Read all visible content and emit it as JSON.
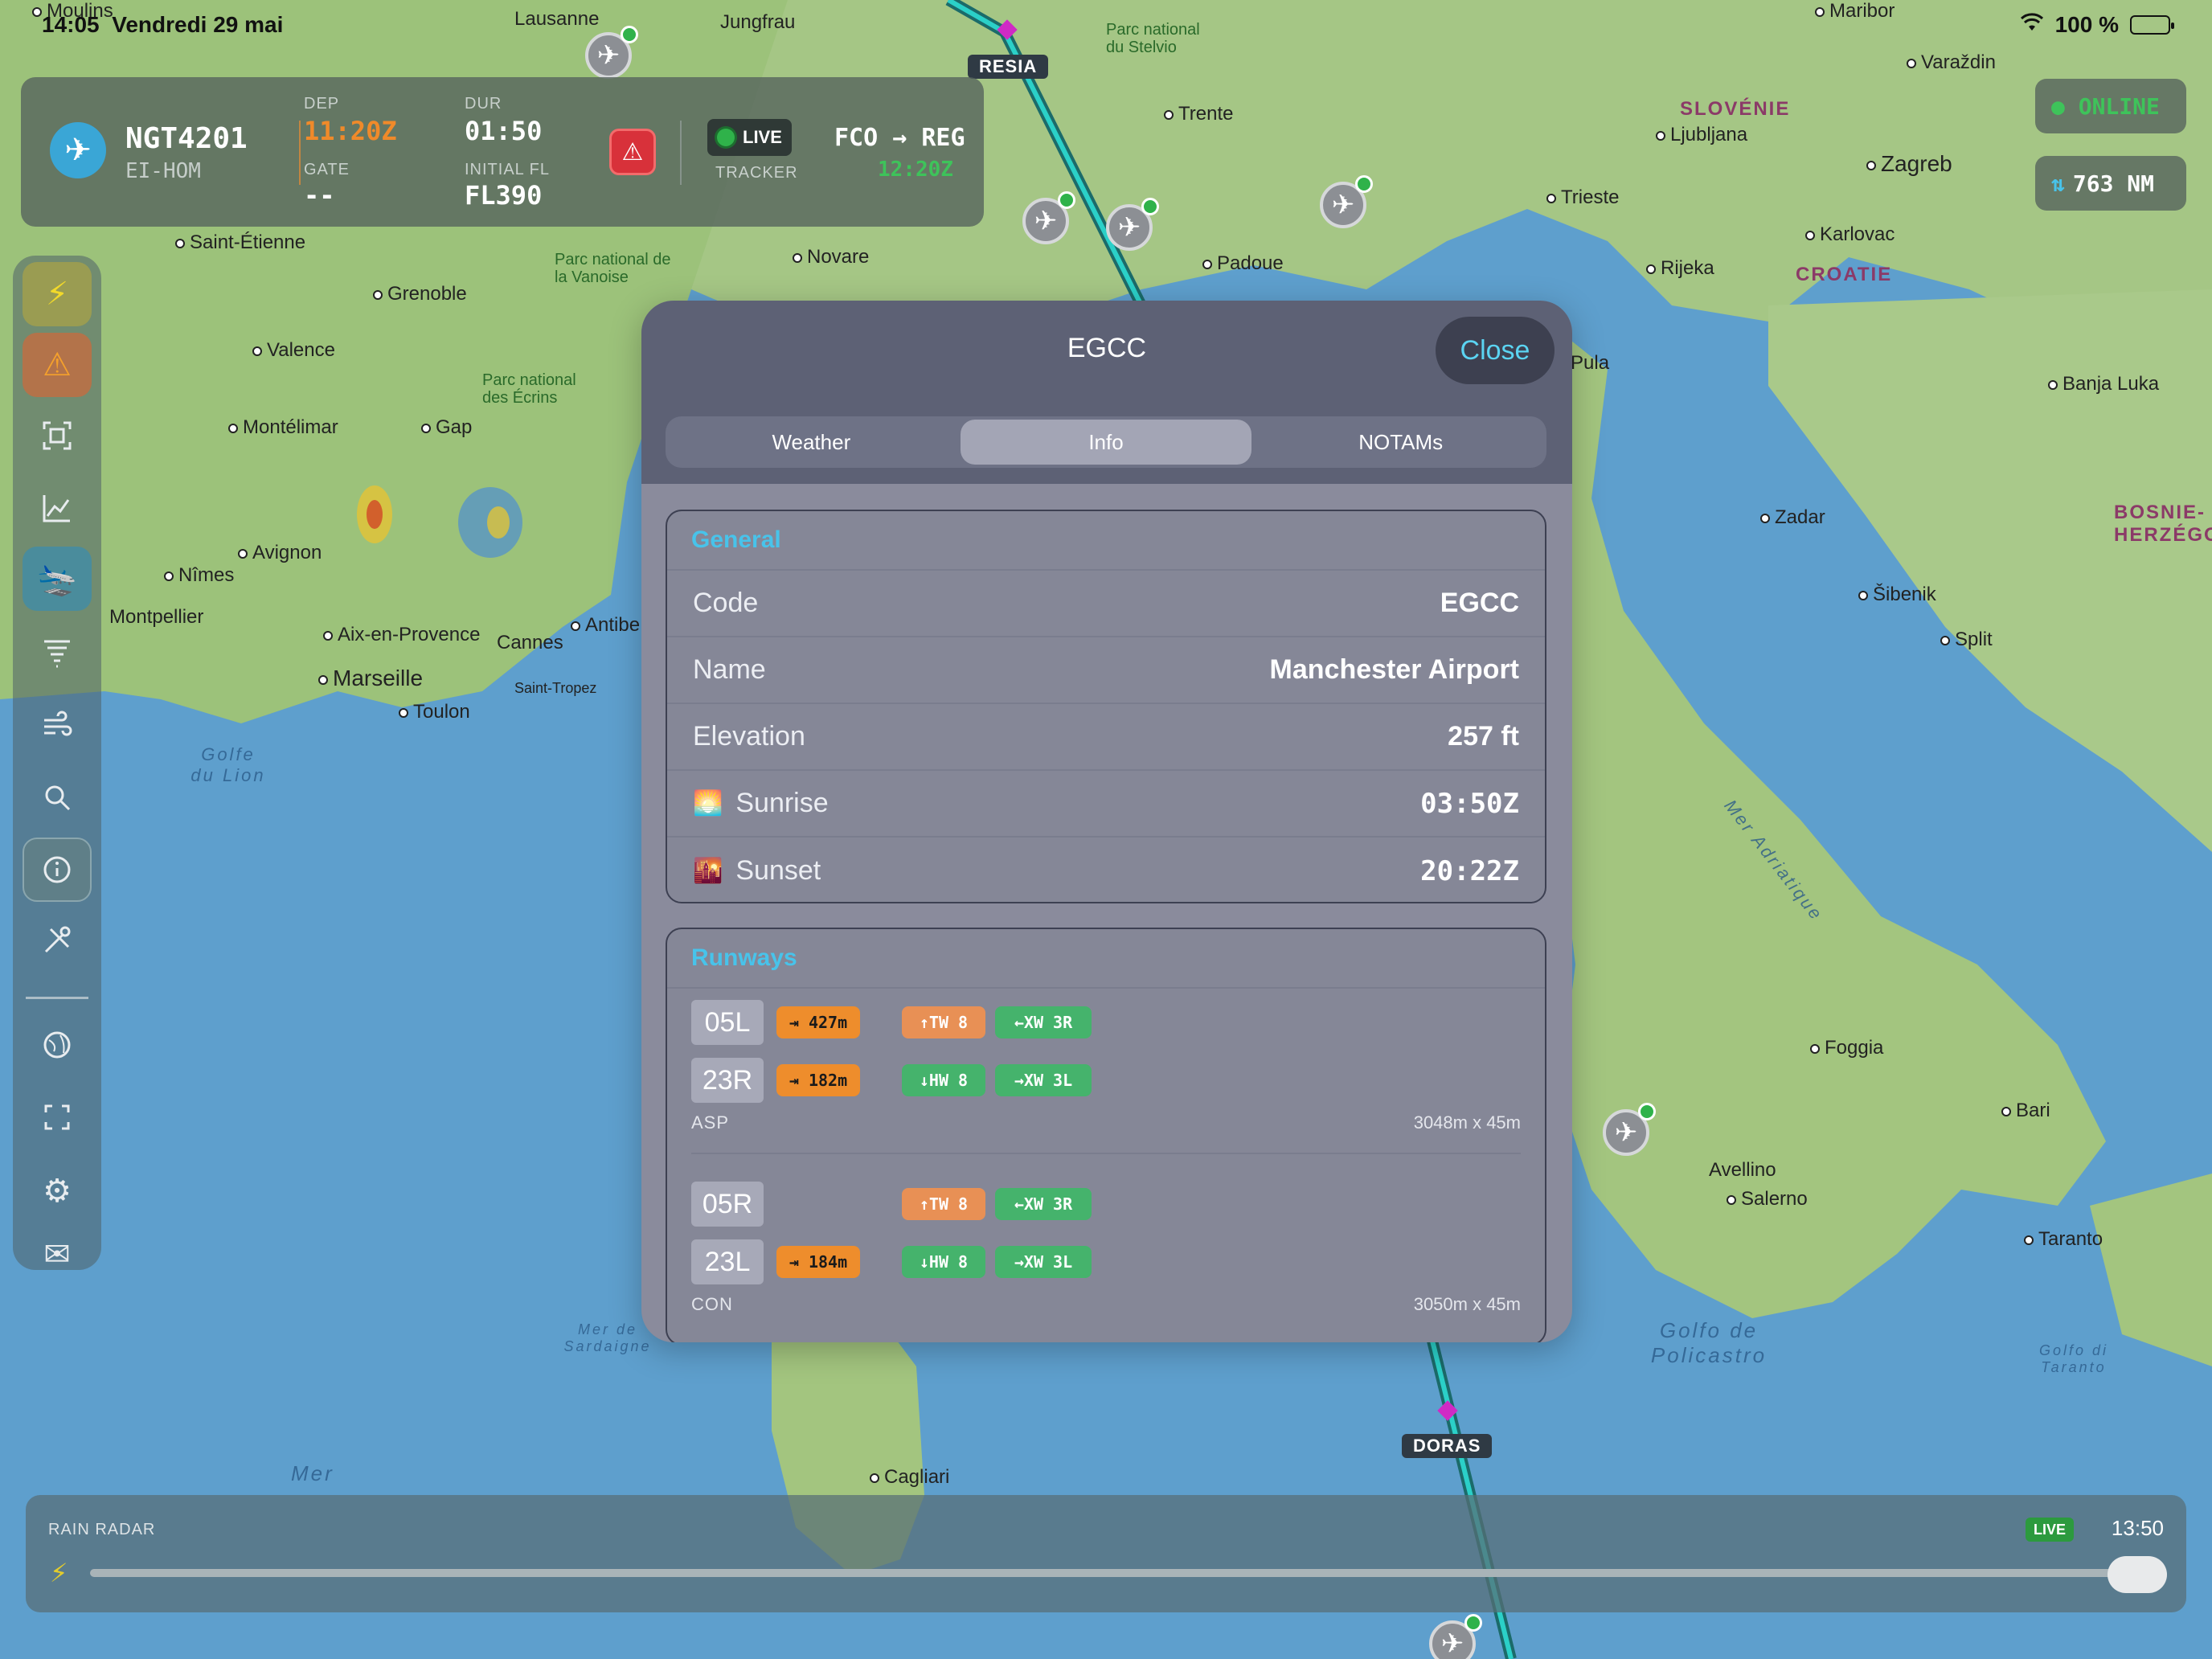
{
  "status": {
    "time": "14:05",
    "date": "Vendredi 29 mai",
    "battery": "100 %"
  },
  "flight": {
    "callsign": "NGT4201",
    "registration": "EI-HOM",
    "dep_label": "DEP",
    "dep_value": "11:20Z",
    "dur_label": "DUR",
    "dur_value": "01:50",
    "gate_label": "GATE",
    "gate_value": "--",
    "fl_label": "INITIAL FL",
    "fl_value": "FL390",
    "live_label": "LIVE",
    "tracker_label": "TRACKER",
    "route": "FCO → REG",
    "utc": "12:20Z"
  },
  "chips": {
    "online": "● ONLINE",
    "distance": "763 NM",
    "distance_icon": "⇅"
  },
  "modal": {
    "title": "EGCC",
    "close_label": "Close",
    "tabs": [
      "Weather",
      "Info",
      "NOTAMs"
    ],
    "active_tab": "Info",
    "general": {
      "title": "General",
      "rows": [
        {
          "label": "Code",
          "value": "EGCC"
        },
        {
          "label": "Name",
          "value": "Manchester Airport"
        },
        {
          "label": "Elevation",
          "value": "257 ft"
        },
        {
          "label": "Sunrise",
          "value": "03:50Z"
        },
        {
          "label": "Sunset",
          "value": "20:22Z"
        }
      ]
    },
    "runways": {
      "title": "Runways",
      "blocks": [
        {
          "ends": [
            {
              "id": "05L",
              "displaced": "⇥ 427m",
              "wind1": "↑TW 8",
              "wind1_color": "orange",
              "wind2": "←XW 3R"
            },
            {
              "id": "23R",
              "displaced": "⇥ 182m",
              "wind1": "↓HW 8",
              "wind1_color": "green",
              "wind2": "→XW 3L"
            }
          ],
          "surface": "ASP",
          "dims": "3048m x 45m"
        },
        {
          "ends": [
            {
              "id": "05R",
              "displaced": "",
              "wind1": "↑TW 8",
              "wind1_color": "orange",
              "wind2": "←XW 3R"
            },
            {
              "id": "23L",
              "displaced": "⇥ 184m",
              "wind1": "↓HW 8",
              "wind1_color": "green",
              "wind2": "→XW 3L"
            }
          ],
          "surface": "CON",
          "dims": "3050m x 45m"
        }
      ]
    }
  },
  "radar": {
    "title": "RAIN RADAR",
    "live": "LIVE",
    "time": "13:50"
  },
  "map": {
    "waypoints": [
      "RESIA",
      "DORAS"
    ],
    "places": [
      "Lausanne",
      "Jungfrau",
      "Parc national du Stelvio",
      "Trente",
      "Maribor",
      "Varaždin",
      "SLOVÉNIE",
      "Ljubljana",
      "Zagreb",
      "Trieste",
      "Karlovac",
      "Rijeka",
      "CROATIE",
      "Padoue",
      "Novare",
      "Saint-Étienne",
      "Grenoble",
      "Parc national de la Vanoise",
      "Valence",
      "Parc national des Écrins",
      "Gap",
      "Montélimar",
      "Avignon",
      "Nîmes",
      "Montpellier",
      "Aix-en-Provence",
      "Marseille",
      "Toulon",
      "Cannes",
      "Antibe",
      "Saint-Tropez",
      "Pula",
      "Banja Luka",
      "Zadar",
      "Šibenik",
      "Split",
      "BOSNIE-HERZÉGO",
      "Golfe du Lion",
      "Mer de Sardaigne",
      "Mer",
      "Cagliari",
      "Foggia",
      "Bari",
      "Avellino",
      "Salerno",
      "Taranto",
      "Golfo de Policastro",
      "Golfo di Taranto",
      "Mer Adriatique",
      "Moulins"
    ]
  },
  "colors": {
    "accent": "#48c3ea",
    "live_green": "#2fb24a",
    "orange": "#ee8d2c",
    "alert": "#d8313a"
  }
}
